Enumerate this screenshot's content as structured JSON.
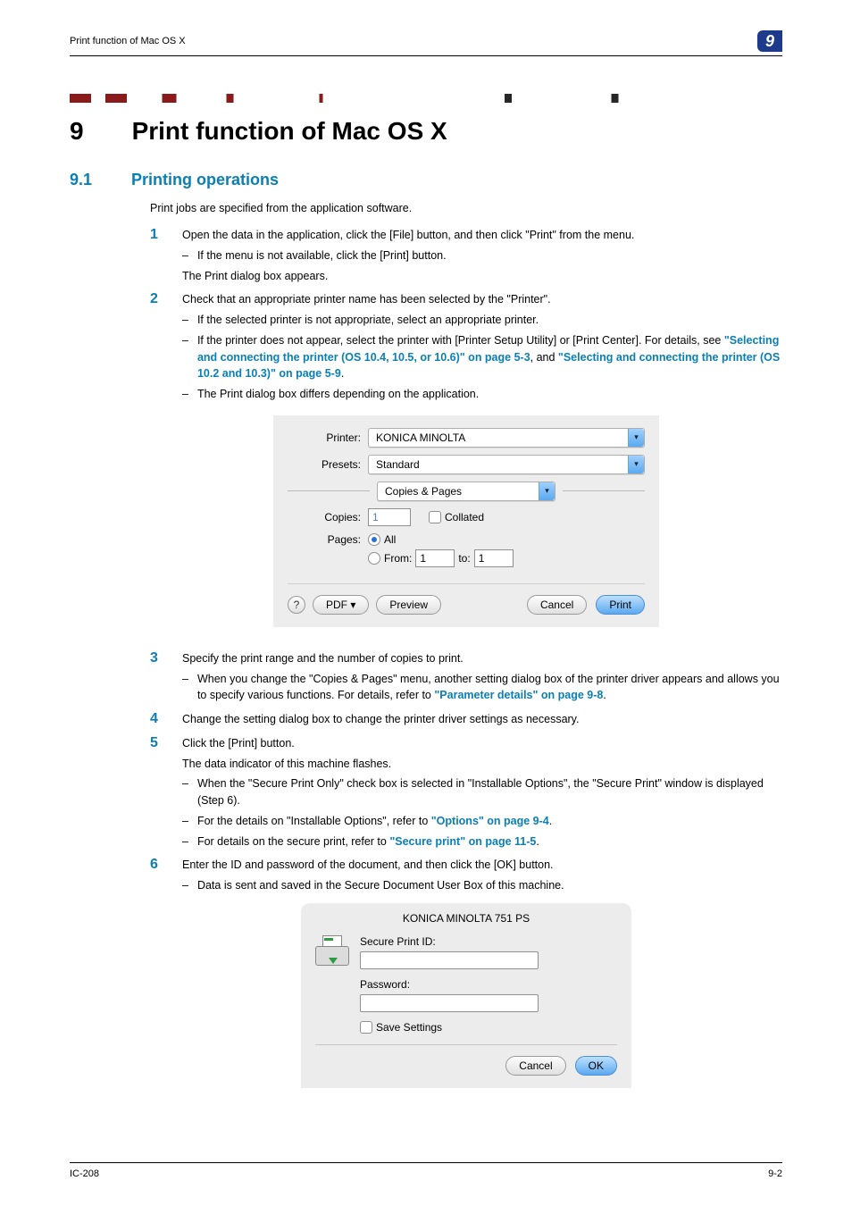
{
  "header": {
    "breadcrumb": "Print function of Mac OS X",
    "tab": "9"
  },
  "h1": {
    "num": "9",
    "text": "Print function of Mac OS X"
  },
  "h2": {
    "num": "9.1",
    "text": "Printing operations"
  },
  "intro": "Print jobs are specified from the application software.",
  "steps": [
    {
      "num": "1",
      "text": "Open the data in the application, click the [File] button, and then click \"Print\" from the menu.",
      "subs": [
        {
          "text": "If the menu is not available, click the [Print] button."
        }
      ],
      "after": "The Print dialog box appears."
    },
    {
      "num": "2",
      "text": "Check that an appropriate printer name has been selected by the \"Printer\".",
      "subs": [
        {
          "text": "If the selected printer is not appropriate, select an appropriate printer."
        },
        {
          "prefix": "If the printer does not appear, select the printer with [Printer Setup Utility] or [Print Center]. For details, see ",
          "link1": "\"Selecting and connecting the printer (OS 10.4, 10.5, or 10.6)\" on page 5-3",
          "middle": ", and ",
          "link2": "\"Selecting and connecting the printer (OS 10.2 and 10.3)\" on page 5-9",
          "suffix": "."
        },
        {
          "text": "The Print dialog box differs depending on the application."
        }
      ]
    },
    {
      "num": "3",
      "text": "Specify the print range and the number of copies to print.",
      "subs": [
        {
          "prefix": "When you change the \"Copies & Pages\" menu, another setting dialog box of the printer driver appears and allows you to specify various functions. For details, refer to ",
          "link1": "\"Parameter details\" on page 9-8",
          "suffix": "."
        }
      ]
    },
    {
      "num": "4",
      "text": "Change the setting dialog box to change the printer driver settings as necessary."
    },
    {
      "num": "5",
      "text": "Click the [Print] button.",
      "after_top": "The data indicator of this machine flashes.",
      "subs": [
        {
          "text": "When the \"Secure Print Only\" check box is selected in \"Installable Options\", the \"Secure Print\" window is displayed (Step 6)."
        },
        {
          "prefix": "For the details on \"Installable Options\", refer to ",
          "link1": "\"Options\" on page 9-4",
          "suffix": "."
        },
        {
          "prefix": "For details on the secure print, refer to ",
          "link1": "\"Secure print\" on page 11-5",
          "suffix": "."
        }
      ]
    },
    {
      "num": "6",
      "text": "Enter the ID and password of the document, and then click the [OK] button.",
      "subs": [
        {
          "text": "Data is sent and saved in the Secure Document User Box of this machine."
        }
      ]
    }
  ],
  "dialog1": {
    "labels": {
      "printer": "Printer:",
      "presets": "Presets:",
      "copies": "Copies:",
      "pages": "Pages:"
    },
    "printer": "KONICA MINOLTA",
    "presets": "Standard",
    "panel": "Copies & Pages",
    "copies_value": "1",
    "collated": "Collated",
    "pages_all": "All",
    "pages_from_label": "From:",
    "pages_from": "1",
    "pages_to_label": "to:",
    "pages_to": "1",
    "help": "?",
    "pdf": "PDF ▾",
    "preview": "Preview",
    "cancel": "Cancel",
    "print": "Print"
  },
  "dialog2": {
    "title": "KONICA MINOLTA 751 PS",
    "secure_id": "Secure Print ID:",
    "password": "Password:",
    "save": "Save Settings",
    "cancel": "Cancel",
    "ok": "OK"
  },
  "footer": {
    "left": "IC-208",
    "right": "9-2"
  }
}
